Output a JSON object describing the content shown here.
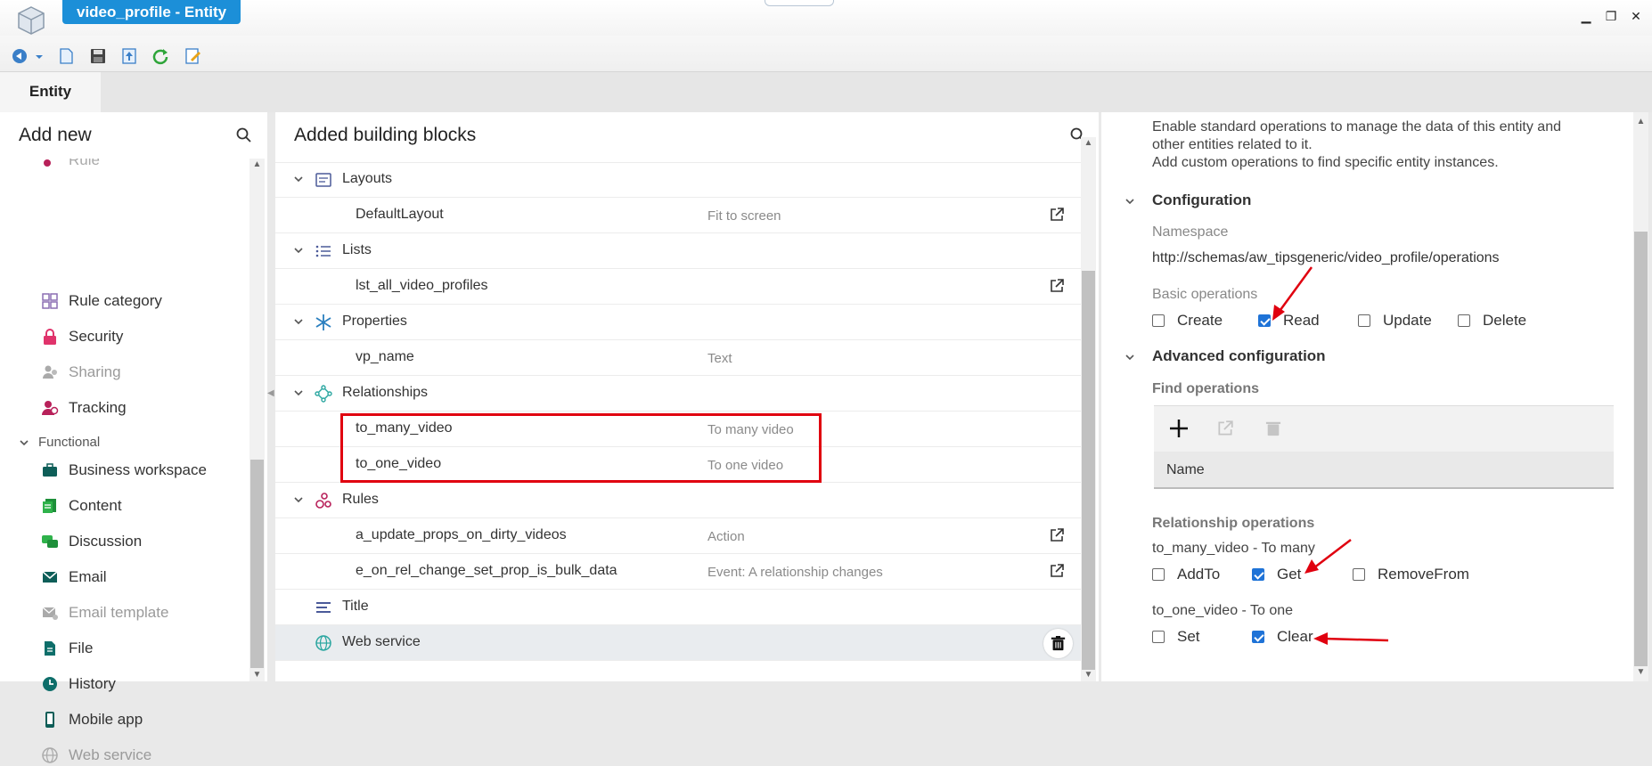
{
  "window": {
    "title": "video_profile - Entity",
    "tab": "Entity"
  },
  "left": {
    "header": "Add new",
    "items_top": [
      {
        "label": "Rule",
        "icon": "rule-icon"
      },
      {
        "label": "Rule category",
        "icon": "rule-category-icon"
      },
      {
        "label": "Security",
        "icon": "lock-icon"
      },
      {
        "label": "Sharing",
        "icon": "sharing-icon"
      },
      {
        "label": "Tracking",
        "icon": "tracking-icon"
      }
    ],
    "group": "Functional",
    "items_functional": [
      {
        "label": "Business workspace"
      },
      {
        "label": "Content"
      },
      {
        "label": "Discussion"
      },
      {
        "label": "Email"
      },
      {
        "label": "Email template"
      },
      {
        "label": "File"
      },
      {
        "label": "History"
      },
      {
        "label": "Mobile app"
      },
      {
        "label": "Web service"
      }
    ]
  },
  "mid": {
    "header": "Added building blocks",
    "rows": [
      {
        "kind": "group",
        "label": "Layouts"
      },
      {
        "kind": "child",
        "label": "DefaultLayout",
        "type": "Fit to screen",
        "ext": true
      },
      {
        "kind": "group",
        "label": "Lists"
      },
      {
        "kind": "child",
        "label": "lst_all_video_profiles",
        "type": "",
        "ext": true
      },
      {
        "kind": "group",
        "label": "Properties"
      },
      {
        "kind": "child",
        "label": "vp_name",
        "type": "Text",
        "ext": false
      },
      {
        "kind": "group",
        "label": "Relationships"
      },
      {
        "kind": "child",
        "label": "to_many_video",
        "type": "To many video",
        "ext": false
      },
      {
        "kind": "child",
        "label": "to_one_video",
        "type": "To one video",
        "ext": false
      },
      {
        "kind": "group",
        "label": "Rules"
      },
      {
        "kind": "child",
        "label": "a_update_props_on_dirty_videos",
        "type": "Action",
        "ext": true
      },
      {
        "kind": "child",
        "label": "e_on_rel_change_set_prop_is_bulk_data",
        "type": "Event: A relationship changes",
        "ext": true
      },
      {
        "kind": "leaf",
        "label": "Title"
      },
      {
        "kind": "leaf",
        "label": "Web service"
      }
    ]
  },
  "right": {
    "desc1": "Enable standard operations to manage the data of this entity and",
    "desc2": "other entities related to it.",
    "desc3": "Add custom operations to find specific entity instances.",
    "config_title": "Configuration",
    "namespace_label": "Namespace",
    "namespace_value": "http://schemas/aw_tipsgeneric/video_profile/operations",
    "basic_ops_label": "Basic operations",
    "basic_ops": [
      {
        "label": "Create",
        "checked": false
      },
      {
        "label": "Read",
        "checked": true
      },
      {
        "label": "Update",
        "checked": false
      },
      {
        "label": "Delete",
        "checked": false
      }
    ],
    "adv_title": "Advanced configuration",
    "find_ops_label": "Find operations",
    "find_col": "Name",
    "rel_ops_label": "Relationship operations",
    "rel1_label": "to_many_video - To many",
    "rel1_ops": [
      {
        "label": "AddTo",
        "checked": false
      },
      {
        "label": "Get",
        "checked": true
      },
      {
        "label": "RemoveFrom",
        "checked": false
      }
    ],
    "rel2_label": "to_one_video - To one",
    "rel2_ops": [
      {
        "label": "Set",
        "checked": false
      },
      {
        "label": "Clear",
        "checked": true
      }
    ]
  },
  "colors": {
    "accent": "#1c8fd8",
    "highlight": "#e0000f",
    "checkbox": "#1f73d7"
  }
}
